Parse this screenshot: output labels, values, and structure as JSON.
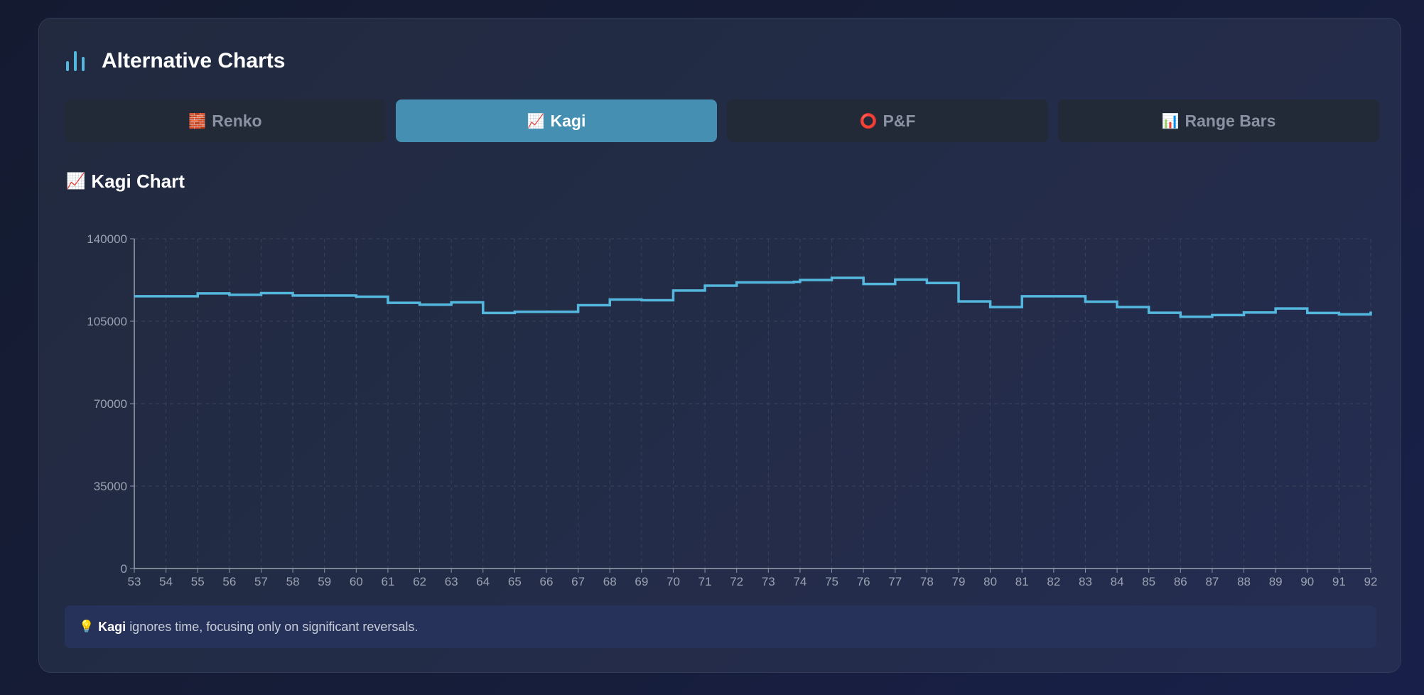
{
  "header": {
    "title": "Alternative Charts",
    "icon": "bar-chart-icon"
  },
  "tabs": [
    {
      "icon": "🧱",
      "label": "Renko",
      "active": false
    },
    {
      "icon": "📈",
      "label": "Kagi",
      "active": true
    },
    {
      "icon": "⭕",
      "label": "P&F",
      "active": false
    },
    {
      "icon": "📊",
      "label": "Range Bars",
      "active": false
    }
  ],
  "section": {
    "icon": "📈",
    "title": "Kagi Chart"
  },
  "colors": {
    "accent": "#4590b2",
    "line": "#54b8de",
    "background": "#1b2238"
  },
  "chart_data": {
    "type": "line",
    "title": "",
    "xlabel": "",
    "ylabel": "",
    "ylim": [
      0,
      140000
    ],
    "yticks": [
      "0",
      "35000",
      "70000",
      "105000",
      "140000"
    ],
    "xlim": [
      53,
      92
    ],
    "x_ticks": [
      "53",
      "54",
      "55",
      "56",
      "57",
      "58",
      "59",
      "60",
      "61",
      "62",
      "63",
      "64",
      "65",
      "66",
      "67",
      "68",
      "69",
      "70",
      "71",
      "72",
      "73",
      "74",
      "75",
      "76",
      "77",
      "78",
      "79",
      "80",
      "81",
      "82",
      "83",
      "84",
      "85",
      "86",
      "87",
      "88",
      "89",
      "90",
      "91",
      "92"
    ],
    "grid": true,
    "series": [
      {
        "step": true,
        "x": [
          53,
          55,
          56,
          57,
          58,
          60,
          61,
          62,
          63,
          64,
          65,
          67,
          68,
          69,
          70,
          71,
          72,
          73.8,
          74,
          75,
          76,
          77,
          78,
          79,
          80,
          81,
          82.8,
          83,
          84,
          85,
          86,
          87,
          88,
          89,
          90,
          91,
          92
        ],
        "values": [
          115600,
          116800,
          116200,
          116900,
          115900,
          115400,
          112800,
          112000,
          113000,
          108500,
          109000,
          111800,
          114200,
          113900,
          118000,
          120100,
          121500,
          121700,
          122500,
          123400,
          120800,
          122700,
          121200,
          113400,
          111000,
          115600,
          115600,
          113300,
          111000,
          108600,
          106900,
          107600,
          108700,
          110400,
          108500,
          107900,
          109100
        ]
      }
    ]
  },
  "note": {
    "icon": "💡",
    "bold": "Kagi",
    "text": "ignores time, focusing only on significant reversals."
  }
}
